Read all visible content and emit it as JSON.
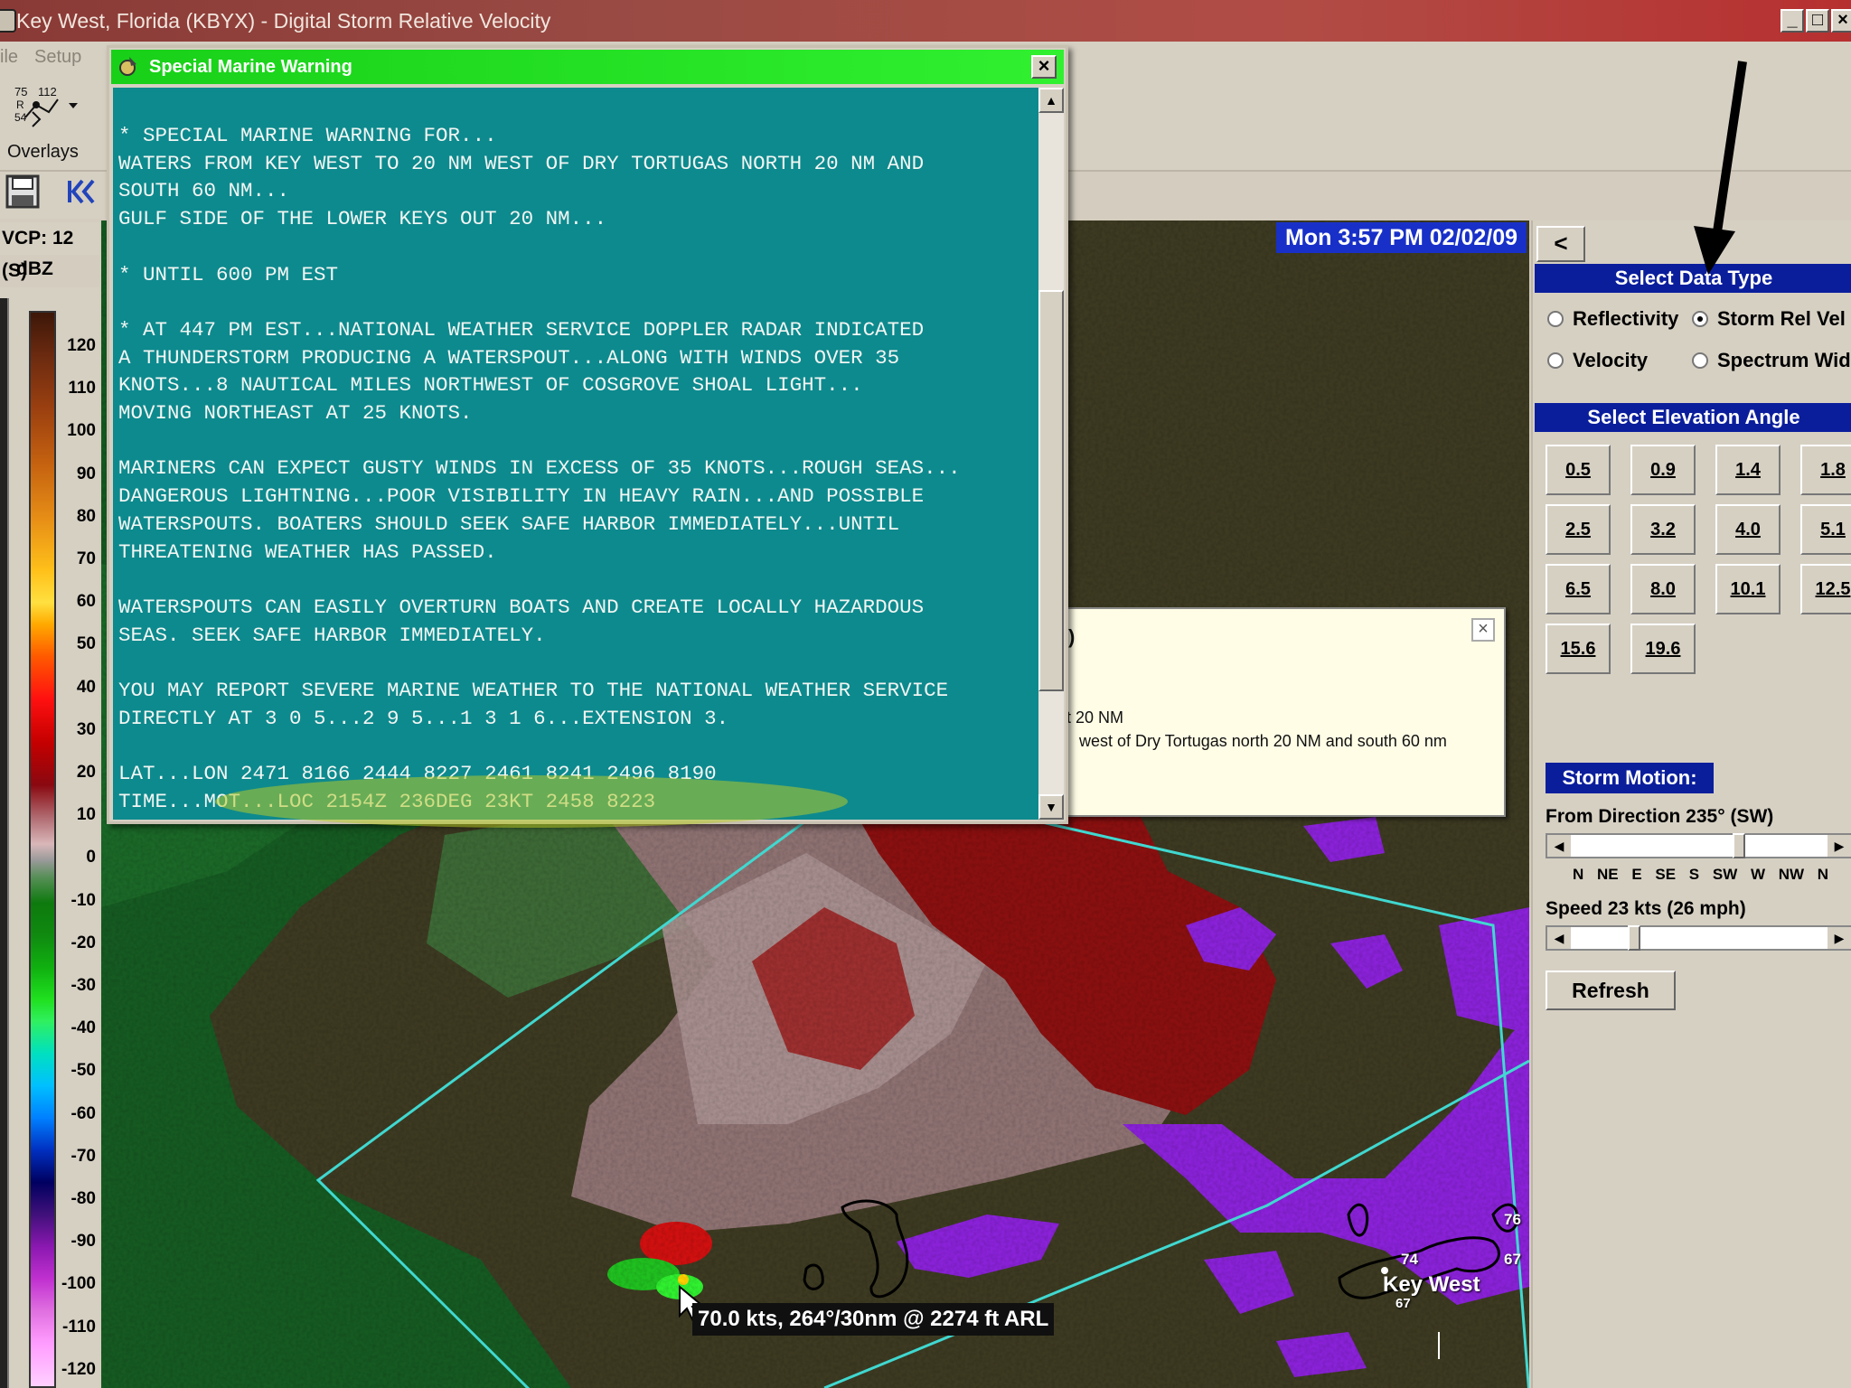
{
  "window": {
    "title": "Key West, Florida (KBYX) - Digital Storm Relative Velocity",
    "min_glyph": "_",
    "max_glyph": "□",
    "close_glyph": "×"
  },
  "menu": [
    "ile",
    "Setup"
  ],
  "toolbar": {
    "overlays_label": "Overlays",
    "overlay_glyph_text": "75 112\n R\n54",
    "save_icon": "floppy-disk-icon",
    "rewind_glyph": "|<<"
  },
  "scale": {
    "vcp": "VCP: 12 (S)",
    "unit": "dBZ",
    "ticks": [
      "120",
      "110",
      "100",
      "90",
      "80",
      "70",
      "60",
      "50",
      "40",
      "30",
      "20",
      "10",
      "0",
      "-10",
      "-20",
      "-30",
      "-40",
      "-50",
      "-60",
      "-70",
      "-80",
      "-90",
      "-100",
      "-110",
      "-120"
    ]
  },
  "radar": {
    "timestamp": "Mon 3:57 PM 02/02/09",
    "readout": "70.0 kts, 264°/30nm @ 2274 ft ARL",
    "city_label": "Key West",
    "marker_74": "74",
    "marker_67a": "67",
    "marker_67b": "67",
    "marker_76": "76"
  },
  "panel": {
    "back_label": "<",
    "data_type_heading": "Select Data Type",
    "data_types": [
      {
        "label": "Reflectivity",
        "selected": false
      },
      {
        "label": "Storm Rel Vel",
        "selected": true
      },
      {
        "label": "Velocity",
        "selected": false
      },
      {
        "label": "Spectrum Wid",
        "selected": false
      }
    ],
    "elevation_heading": "Select Elevation Angle",
    "elevations": [
      "0.5",
      "0.9",
      "1.4",
      "1.8",
      "2.5",
      "3.2",
      "4.0",
      "5.1",
      "6.5",
      "8.0",
      "10.1",
      "12.5",
      "15.6",
      "19.6"
    ],
    "storm_motion_heading": "Storm Motion:",
    "direction_label": "From Direction 235° (SW)",
    "direction_value_deg": 235,
    "directions": "N NE E SE S SW W NW N",
    "speed_label": "Speed 23 kts (26 mph)",
    "speed_value_kts": 23,
    "refresh_label": "Refresh"
  },
  "popup": {
    "fragment": ")",
    "line1": "t 20 NM",
    "line2": "west of Dry Tortugas north 20 NM and south 60 nm",
    "close_glyph": "×"
  },
  "warning": {
    "title": "Special Marine Warning",
    "close_glyph": "×",
    "text": "* SPECIAL MARINE WARNING FOR...\nWATERS FROM KEY WEST TO 20 NM WEST OF DRY TORTUGAS NORTH 20 NM AND\nSOUTH 60 NM...\nGULF SIDE OF THE LOWER KEYS OUT 20 NM...\n\n* UNTIL 600 PM EST\n\n* AT 447 PM EST...NATIONAL WEATHER SERVICE DOPPLER RADAR INDICATED\nA THUNDERSTORM PRODUCING A WATERSPOUT...ALONG WITH WINDS OVER 35\nKNOTS...8 NAUTICAL MILES NORTHWEST OF COSGROVE SHOAL LIGHT...\nMOVING NORTHEAST AT 25 KNOTS.\n\nMARINERS CAN EXPECT GUSTY WINDS IN EXCESS OF 35 KNOTS...ROUGH SEAS...\nDANGEROUS LIGHTNING...POOR VISIBILITY IN HEAVY RAIN...AND POSSIBLE\nWATERSPOUTS. BOATERS SHOULD SEEK SAFE HARBOR IMMEDIATELY...UNTIL\nTHREATENING WEATHER HAS PASSED.\n\nWATERSPOUTS CAN EASILY OVERTURN BOATS AND CREATE LOCALLY HAZARDOUS\nSEAS. SEEK SAFE HARBOR IMMEDIATELY.\n\nYOU MAY REPORT SEVERE MARINE WEATHER TO THE NATIONAL WEATHER SERVICE\nDIRECTLY AT 3 0 5...2 9 5...1 3 1 6...EXTENSION 3.\n\nLAT...LON 2471 8166 2444 8227 2461 8241 2496 8190\nTIME...MOT...LOC 2154Z 236DEG 23KT 2458 8223"
  },
  "colors": {
    "title_bar": "#9a4b44",
    "warning_title": "#20e020",
    "warning_body": "#0d8a8e",
    "panel_heading": "#0a1e9c",
    "timestamp_bg": "#1830c8",
    "polygon": "#40d8d0"
  }
}
